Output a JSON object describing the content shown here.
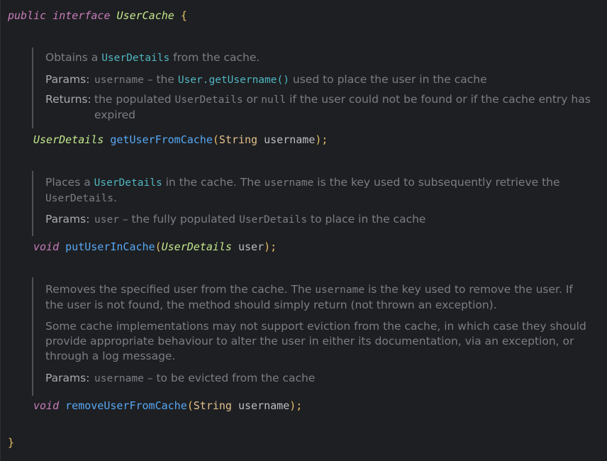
{
  "header": {
    "kw_public": "public",
    "kw_interface": "interface",
    "iface_name": "UserCache",
    "open_brace": "{"
  },
  "doc1": {
    "desc_pre": "Obtains a ",
    "desc_link": "UserDetails",
    "desc_post": " from the cache.",
    "params_tag": "Params:",
    "params_name": "username",
    "params_dash": " – the ",
    "params_link": "User.getUsername()",
    "params_post": " used to place the user in the cache",
    "returns_tag": "Returns:",
    "returns_pre": "the populated ",
    "returns_mono1": "UserDetails",
    "returns_mid": " or ",
    "returns_mono2": "null",
    "returns_post": " if the user could not be found or if the cache entry has expired"
  },
  "method1": {
    "return_type": "UserDetails",
    "name": "getUserFromCache",
    "open_paren": "(",
    "param_type": "String",
    "param_name": "username",
    "close": ");"
  },
  "doc2": {
    "desc_pre": "Places a ",
    "desc_link": "UserDetails",
    "desc_mid": " in the cache. The ",
    "desc_mono": "username",
    "desc_post": " is the key used to subsequently retrieve the ",
    "desc_mono2": "UserDetails",
    "desc_end": ".",
    "params_tag": "Params:",
    "params_name": "user",
    "params_mid": " – the fully populated ",
    "params_mono": "UserDetails",
    "params_post": " to place in the cache"
  },
  "method2": {
    "return_type": "void",
    "name": "putUserInCache",
    "open_paren": "(",
    "param_type": "UserDetails",
    "param_name": "user",
    "close": ");"
  },
  "doc3": {
    "desc1_pre": "Removes the specified user from the cache. The ",
    "desc1_mono": "username",
    "desc1_post": " is the key used to remove the user. If the user is not found, the method should simply return (not thrown an exception).",
    "desc2": "Some cache implementations may not support eviction from the cache, in which case they should provide appropriate behaviour to alter the user in either its documentation, via an exception, or through a log message.",
    "params_tag": "Params:",
    "params_name": "username",
    "params_post": " – to be evicted from the cache"
  },
  "method3": {
    "return_type": "void",
    "name": "removeUserFromCache",
    "open_paren": "(",
    "param_type": "String",
    "param_name": "username",
    "close": ");"
  },
  "footer": {
    "close_brace": "}"
  }
}
